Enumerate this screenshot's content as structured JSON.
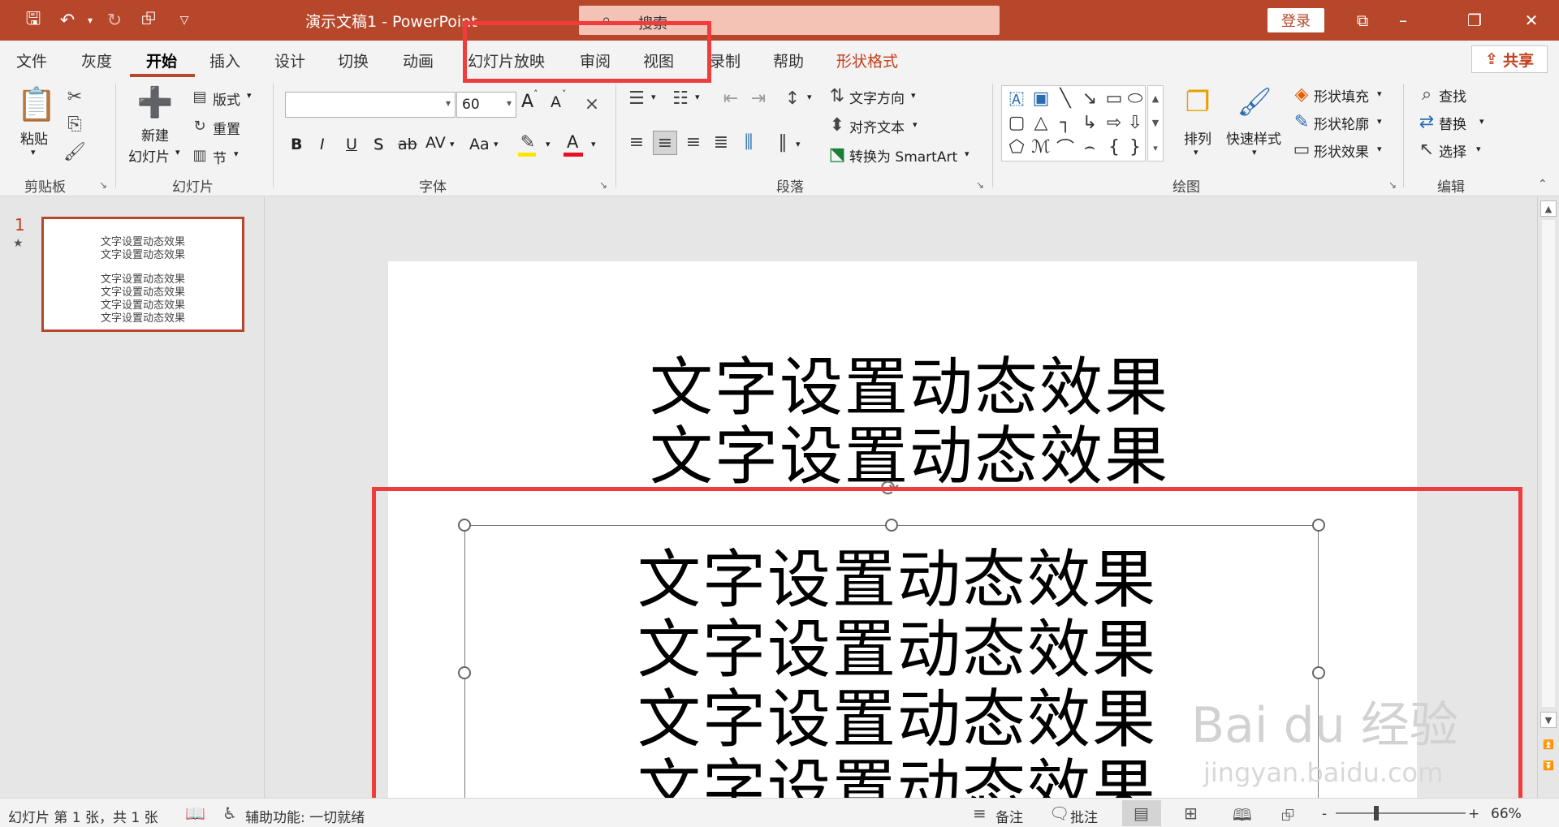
{
  "titlebar": {
    "doc_title": "演示文稿1  -  PowerPoint",
    "search_placeholder": "搜索",
    "login": "登录",
    "icons": [
      "save-icon",
      "undo-icon",
      "redo-icon",
      "present-icon",
      "customize-icon"
    ]
  },
  "tabs": [
    "文件",
    "灰度",
    "开始",
    "插入",
    "设计",
    "切换",
    "动画",
    "幻灯片放映",
    "审阅",
    "视图",
    "录制",
    "帮助",
    "形状格式"
  ],
  "active_tab": "开始",
  "share": "共享",
  "ribbon": {
    "clipboard": {
      "label": "剪贴板",
      "paste": "粘贴"
    },
    "slides": {
      "label": "幻灯片",
      "new_slide_1": "新建",
      "new_slide_2": "幻灯片",
      "layout": "版式",
      "reset": "重置",
      "section": "节"
    },
    "font": {
      "label": "字体",
      "font_name": "",
      "font_size": "60",
      "bold": "B",
      "italic": "I",
      "underline": "U",
      "shadow": "S",
      "strike": "ab",
      "spacing": "AV",
      "case": "Aa",
      "grow": "A",
      "shrink": "A"
    },
    "paragraph": {
      "label": "段落",
      "text_direction": "文字方向",
      "align_text": "对齐文本",
      "smartart": "转换为 SmartArt"
    },
    "drawing": {
      "label": "绘图",
      "arrange": "排列",
      "quick_styles": "快速样式",
      "fill": "形状填充",
      "outline": "形状轮廓",
      "effects": "形状效果"
    },
    "editing": {
      "label": "编辑",
      "find": "查找",
      "replace": "替换",
      "select": "选择"
    }
  },
  "thumbnail": {
    "number": "1",
    "lines": [
      "文字设置动态效果",
      "文字设置动态效果",
      "文字设置动态效果",
      "文字设置动态效果",
      "文字设置动态效果",
      "文字设置动态效果"
    ]
  },
  "slide": {
    "title_lines": [
      "文字设置动态效果",
      "文字设置动态效果"
    ],
    "body_lines": [
      "文字设置动态效果",
      "文字设置动态效果",
      "文字设置动态效果",
      "文字设置动态效果"
    ]
  },
  "status": {
    "slide_info": "幻灯片 第 1 张，共 1 张",
    "accessibility": "辅助功能: 一切就绪",
    "notes": "备注",
    "comments": "批注",
    "zoom": "66%",
    "zoom_minus": "-",
    "zoom_plus": "+"
  },
  "watermark": {
    "main": "Bai du 经验",
    "sub": "jingyan.baidu.com"
  },
  "colors": {
    "accent": "#b7472a",
    "highlight": "#f03c3c"
  }
}
